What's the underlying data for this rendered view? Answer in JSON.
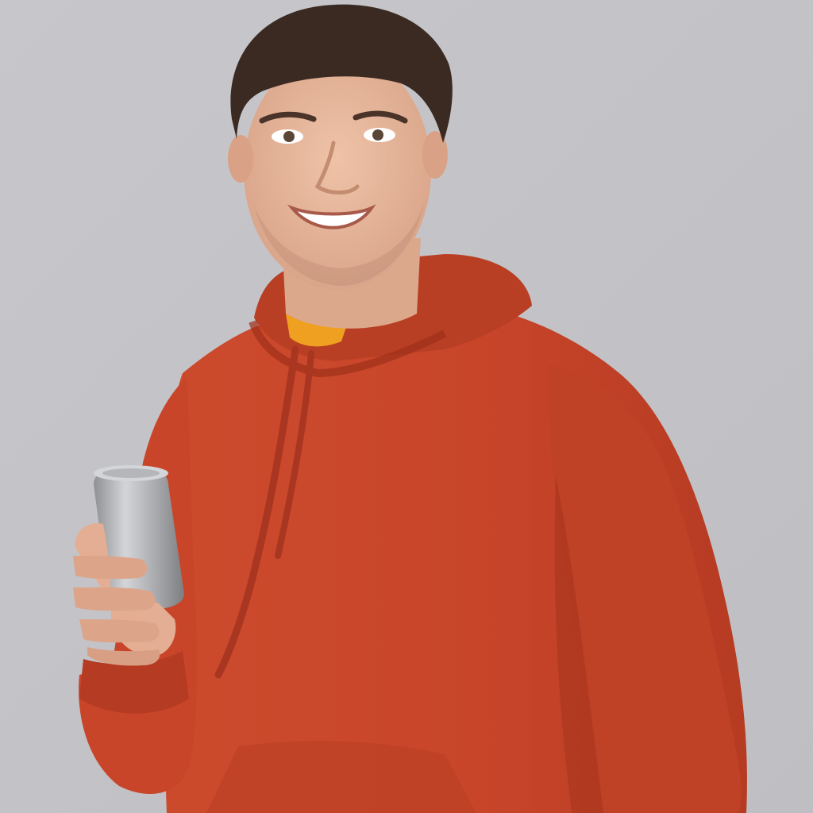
{
  "photo": {
    "subject": "person",
    "colors": {
      "background": "#c4c4c8",
      "hoodie": "#c8452a",
      "hoodie_shadow": "#9e3119",
      "hoodie_light": "#dc5a3a",
      "skin": "#e8b79c",
      "skin_shadow": "#cf9a7e",
      "hair": "#3a2a22",
      "undershirt": "#f0a020",
      "can": "#a6a8ab",
      "can_light": "#d3d5d8"
    }
  }
}
